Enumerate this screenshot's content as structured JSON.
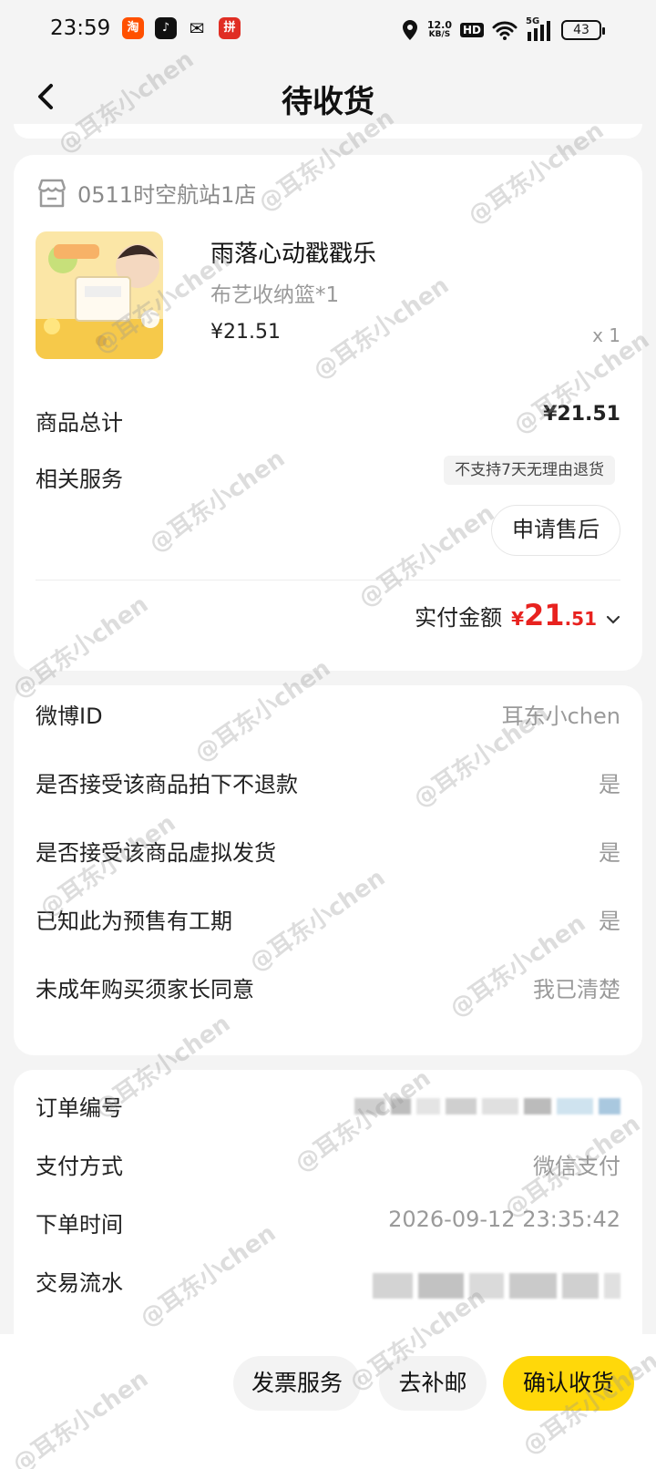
{
  "status_bar": {
    "time": "23:59",
    "apps": [
      "淘",
      "♪",
      "✉",
      "拼"
    ],
    "speed_value": "12.0",
    "speed_unit": "KB/S",
    "hd": "HD",
    "network": "5G",
    "battery": "43"
  },
  "nav": {
    "title": "待收货",
    "back_icon": "chevron-left-icon"
  },
  "order": {
    "shop_name": "0511时空航站1店",
    "product_title": "雨落心动戳戳乐",
    "product_spec": "布艺收纳篮*1",
    "product_price": "¥21.51",
    "product_qty": "x 1",
    "total_label": "商品总计",
    "total_value": "¥21.51",
    "service_label": "相关服务",
    "service_badge": "不支持7天无理由退货",
    "after_sale_button": "申请售后",
    "paid_label": "实付金额",
    "paid_currency": "¥",
    "paid_int": "21",
    "paid_decimal": ".51"
  },
  "info": {
    "rows": [
      {
        "label": "微博ID",
        "value": "耳东小chen"
      },
      {
        "label": "是否接受该商品拍下不退款",
        "value": "是"
      },
      {
        "label": "是否接受该商品虚拟发货",
        "value": "是"
      },
      {
        "label": "已知此为预售有工期",
        "value": "是"
      },
      {
        "label": "未成年购买须家长同意",
        "value": "我已清楚"
      }
    ]
  },
  "meta": {
    "order_no_label": "订单编号",
    "pay_method_label": "支付方式",
    "pay_method_value": "微信支付",
    "order_time_label": "下单时间",
    "order_time_value": "2026-09-12 23:35:42",
    "transaction_label": "交易流水"
  },
  "bottom": {
    "invoice": "发票服务",
    "postage": "去补邮",
    "confirm": "确认收货"
  },
  "colors": {
    "accent_yellow": "#ffd80a",
    "price_red": "#e8221f",
    "background": "#f4f4f4"
  },
  "watermark": "@耳东小chen"
}
